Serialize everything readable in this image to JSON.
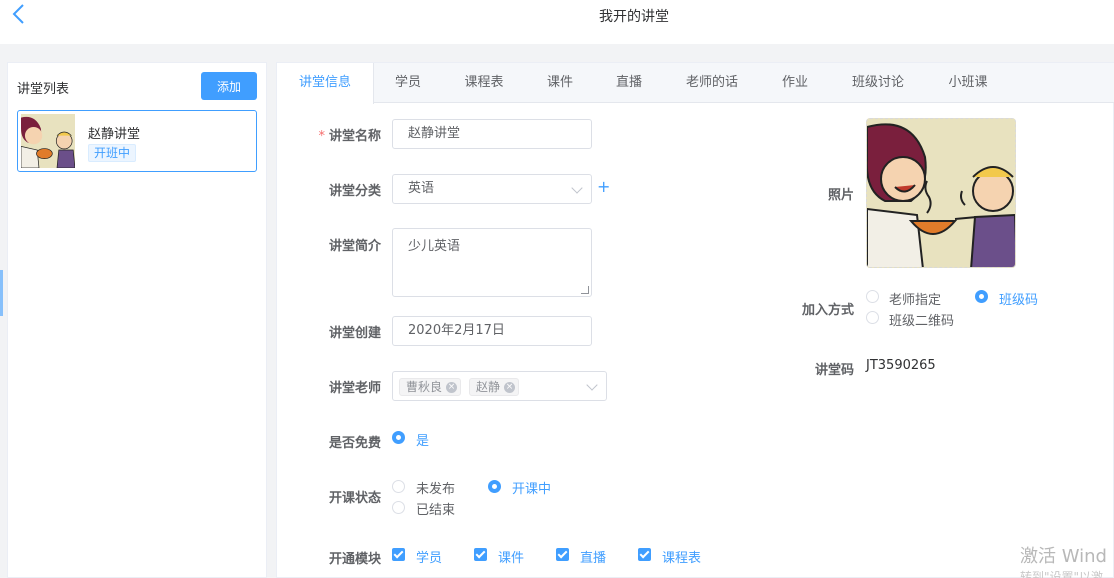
{
  "header": {
    "title": "我开的讲堂",
    "back_icon": "chevron-left-icon"
  },
  "sidebar": {
    "title": "讲堂列表",
    "add_label": "添加",
    "cards": [
      {
        "name": "赵静讲堂",
        "status": "开班中"
      }
    ]
  },
  "tabs": [
    "讲堂信息",
    "学员",
    "课程表",
    "课件",
    "直播",
    "老师的话",
    "作业",
    "班级讨论",
    "小班课"
  ],
  "form": {
    "name": {
      "label": "讲堂名称",
      "value": "赵静讲堂"
    },
    "category": {
      "label": "讲堂分类",
      "value": "英语"
    },
    "intro": {
      "label": "讲堂简介",
      "value": "少儿英语"
    },
    "created": {
      "label": "讲堂创建",
      "value": "2020年2月17日"
    },
    "teachers": {
      "label": "讲堂老师",
      "tags": [
        "曹秋良",
        "赵静"
      ]
    },
    "free": {
      "label": "是否免费",
      "option": "是"
    },
    "status": {
      "label": "开课状态",
      "options": [
        "未发布",
        "开课中",
        "已结束"
      ],
      "selected": "开课中"
    },
    "modules": {
      "label": "开通模块",
      "items": [
        "学员",
        "课件",
        "直播",
        "课程表"
      ]
    },
    "photo_label": "照片",
    "join": {
      "label": "加入方式",
      "options": [
        "老师指定",
        "班级码",
        "班级二维码"
      ],
      "selected": "班级码"
    },
    "code": {
      "label": "讲堂码",
      "value": "JT3590265"
    }
  },
  "watermark": {
    "line1": "激活 Wind",
    "line2": "转到\"设置\"以激"
  },
  "colors": {
    "accent": "#409eff",
    "required": "#f56c6c"
  }
}
